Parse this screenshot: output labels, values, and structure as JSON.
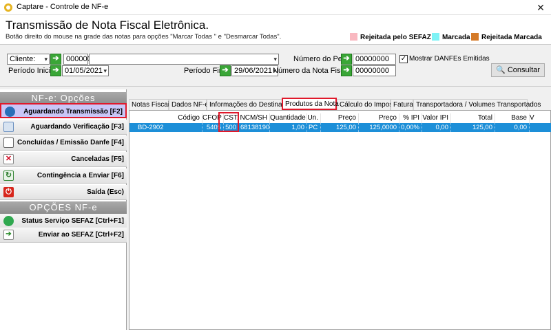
{
  "window": {
    "title": "Captare - Controle de  NF-e",
    "close_symbol": "✕"
  },
  "header": {
    "title": "Transmissão de Nota Fiscal Eletrônica.",
    "hint": "Botão direito do mouse na grade das notas para opções \"Marcar Todas \" e \"Desmarcar Todas\".",
    "legend": [
      {
        "label": "Rejeitada pelo SEFAZ",
        "color": "#f9b8c0"
      },
      {
        "label": "Marcada",
        "color": "#7ff3f6"
      },
      {
        "label": "Rejeitada Marcada",
        "color": "#d57a28"
      }
    ]
  },
  "filters": {
    "cliente_label": "Cliente:",
    "cliente_code": "000000",
    "cliente_name": "",
    "periodo_inicial_label": "Período Inicial:",
    "periodo_inicial": "01/05/2021",
    "periodo_final_label": "Período Final:",
    "periodo_final": "29/06/2021",
    "numero_pedido_label": "Número do Pedido:",
    "numero_pedido": "00000000",
    "numero_nota_label": "Número da Nota Fiscal:",
    "numero_nota": "00000000",
    "mostrar_danfes_label": "Mostrar DANFEs Emitidas",
    "mostrar_danfes_checked": true,
    "consultar_label": "Consultar"
  },
  "sidebar": {
    "section1": "NF-e:  Opções",
    "section2": "OPÇÕES  NF-e",
    "items": [
      {
        "label": "Aguardando Transmissão [F2]",
        "icon": "globe-icon",
        "active": true
      },
      {
        "label": "Aguardando Verificação [F3]",
        "icon": "search-doc-icon"
      },
      {
        "label": "Concluídas / Emissão Danfe [F4]",
        "icon": "window-icon"
      },
      {
        "label": "Canceladas [F5]",
        "icon": "cancel-doc-icon"
      },
      {
        "label": "Contingência a Enviar [F6]",
        "icon": "refresh-icon"
      },
      {
        "label": "Saída (Esc)",
        "icon": "power-icon"
      }
    ],
    "items2": [
      {
        "label": "Status Serviço SEFAZ [Ctrl+F1]",
        "icon": "status-icon"
      },
      {
        "label": "Enviar ao SEFAZ [Ctrl+F2]",
        "icon": "send-icon"
      }
    ]
  },
  "tabs": [
    {
      "label": "Notas Fiscais"
    },
    {
      "label": "Dados NF-e"
    },
    {
      "label": "Informações do Destinatário"
    },
    {
      "label": "Produtos da Nota",
      "active": true
    },
    {
      "label": "Cálculo do Imposto"
    },
    {
      "label": "Fatura"
    },
    {
      "label": "Transportadora / Volumes Transportados"
    }
  ],
  "grid": {
    "columns": [
      "Código",
      "CFOP",
      "CST.",
      "NCM/SH",
      "Quantidade",
      "Un.",
      "Preço Bruto",
      "Preço Líquido",
      "% IPI",
      "Valor IPI",
      "Total Produtos",
      "Base ICMS",
      "V"
    ],
    "rows": [
      [
        "BD-2902",
        "5405",
        "500",
        "68138190",
        "1,00",
        "PC",
        "125,00",
        "125,0000",
        "0,00%",
        "0,00",
        "125,00",
        "0,00",
        ""
      ]
    ]
  }
}
